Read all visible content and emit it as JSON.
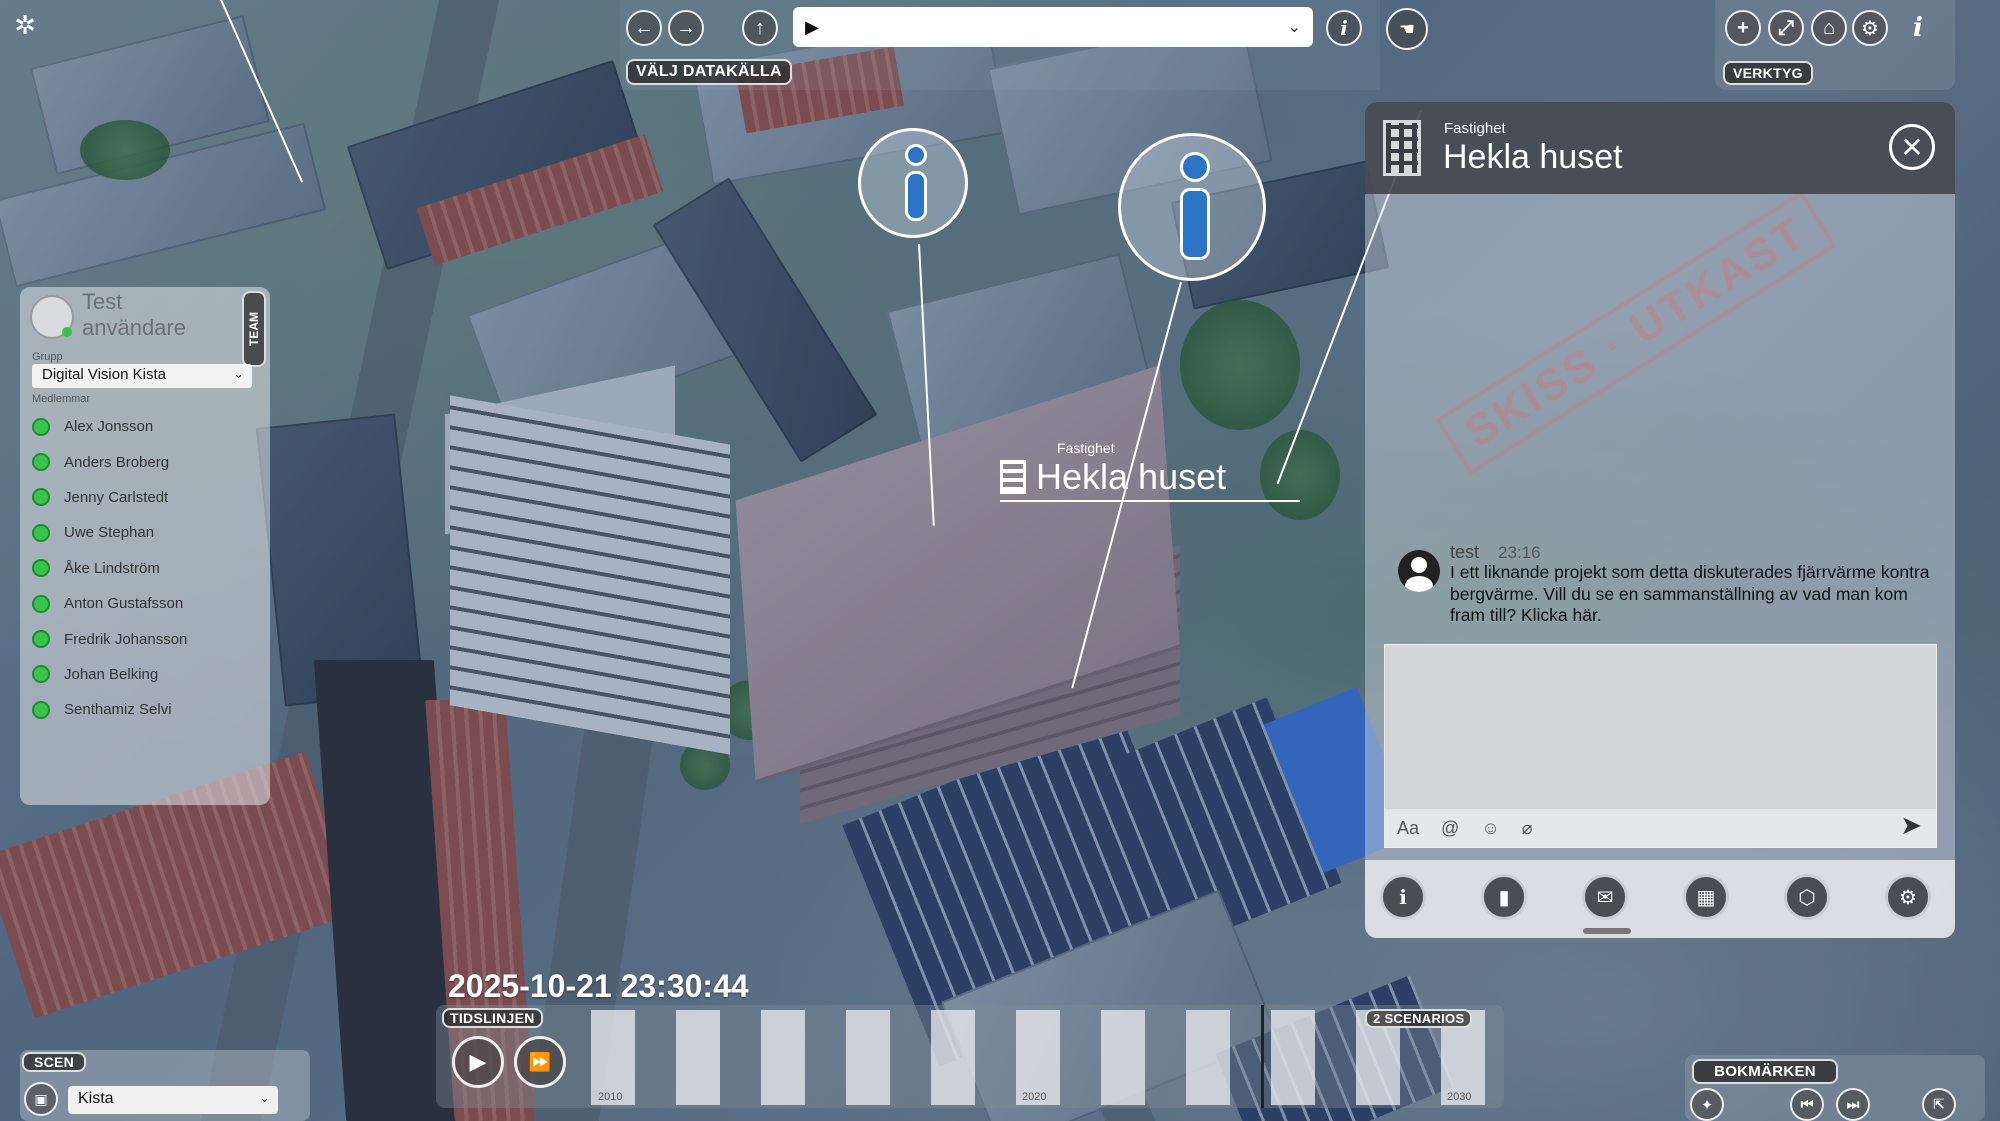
{
  "topbar": {
    "nav_back": "←",
    "nav_forward": "→",
    "upload_icon": "↑",
    "datasource_label": "VÄLJ DATAKÄLLA",
    "datasource_value": "▶",
    "info_icon": "i"
  },
  "tools": {
    "label": "VERKTYG",
    "add": "+",
    "fit": "⤢",
    "home": "⌂",
    "settings": "⚙",
    "info": "i"
  },
  "team": {
    "user_name": "Test användare",
    "tab_label": "TEAM",
    "group_label": "Grupp",
    "group_value": "Digital Vision Kista",
    "members_label": "Medlemmar",
    "members": [
      {
        "name": "Alex Jonsson"
      },
      {
        "name": "Anders Broberg"
      },
      {
        "name": "Jenny Carlstedt"
      },
      {
        "name": "Uwe Stephan"
      },
      {
        "name": "Åke Lindström"
      },
      {
        "name": "Anton Gustafsson"
      },
      {
        "name": "Fredrik Johansson"
      },
      {
        "name": "Johan Belking"
      },
      {
        "name": "Senthamiz Selvi"
      }
    ]
  },
  "map_label": {
    "category": "Fastighet",
    "name": "Hekla huset"
  },
  "property_panel": {
    "category": "Fastighet",
    "title": "Hekla huset",
    "close_icon": "✕",
    "comment": {
      "author": "test",
      "time": "23:16",
      "text": "I ett liknande projekt som detta diskuterades fjärrvärme kontra bergvärme. Vill du se en sammanställning av vad man kom fram till? Klicka här."
    },
    "compose": {
      "font_icon": "Aa",
      "mention_icon": "@",
      "emoji_icon": "☺",
      "attach_icon": "⌀",
      "send_icon": "➤"
    },
    "tabs": [
      {
        "icon": "i"
      },
      {
        "icon": "▮"
      },
      {
        "icon": "✉"
      },
      {
        "icon": "▦"
      },
      {
        "icon": "⬡"
      },
      {
        "icon": "⚙"
      }
    ]
  },
  "timeline": {
    "clock": "2025-10-21 23:30:44",
    "label": "TIDSLINJEN",
    "scenarios_label": "2 SCENARIOS",
    "play_icon": "▶",
    "ffwd_icon": "⏩",
    "years": [
      "2010",
      "2020",
      "2030"
    ]
  },
  "scene": {
    "label": "SCEN",
    "value": "Kista"
  },
  "bookmarks": {
    "label": "BOKMÄRKEN",
    "icons": [
      "✦",
      "⏮",
      "⏭",
      "⇱"
    ]
  },
  "colors": {
    "accent_blue": "#2a73c5",
    "status_green": "#38c44d",
    "panel_header": "#3c4046"
  }
}
